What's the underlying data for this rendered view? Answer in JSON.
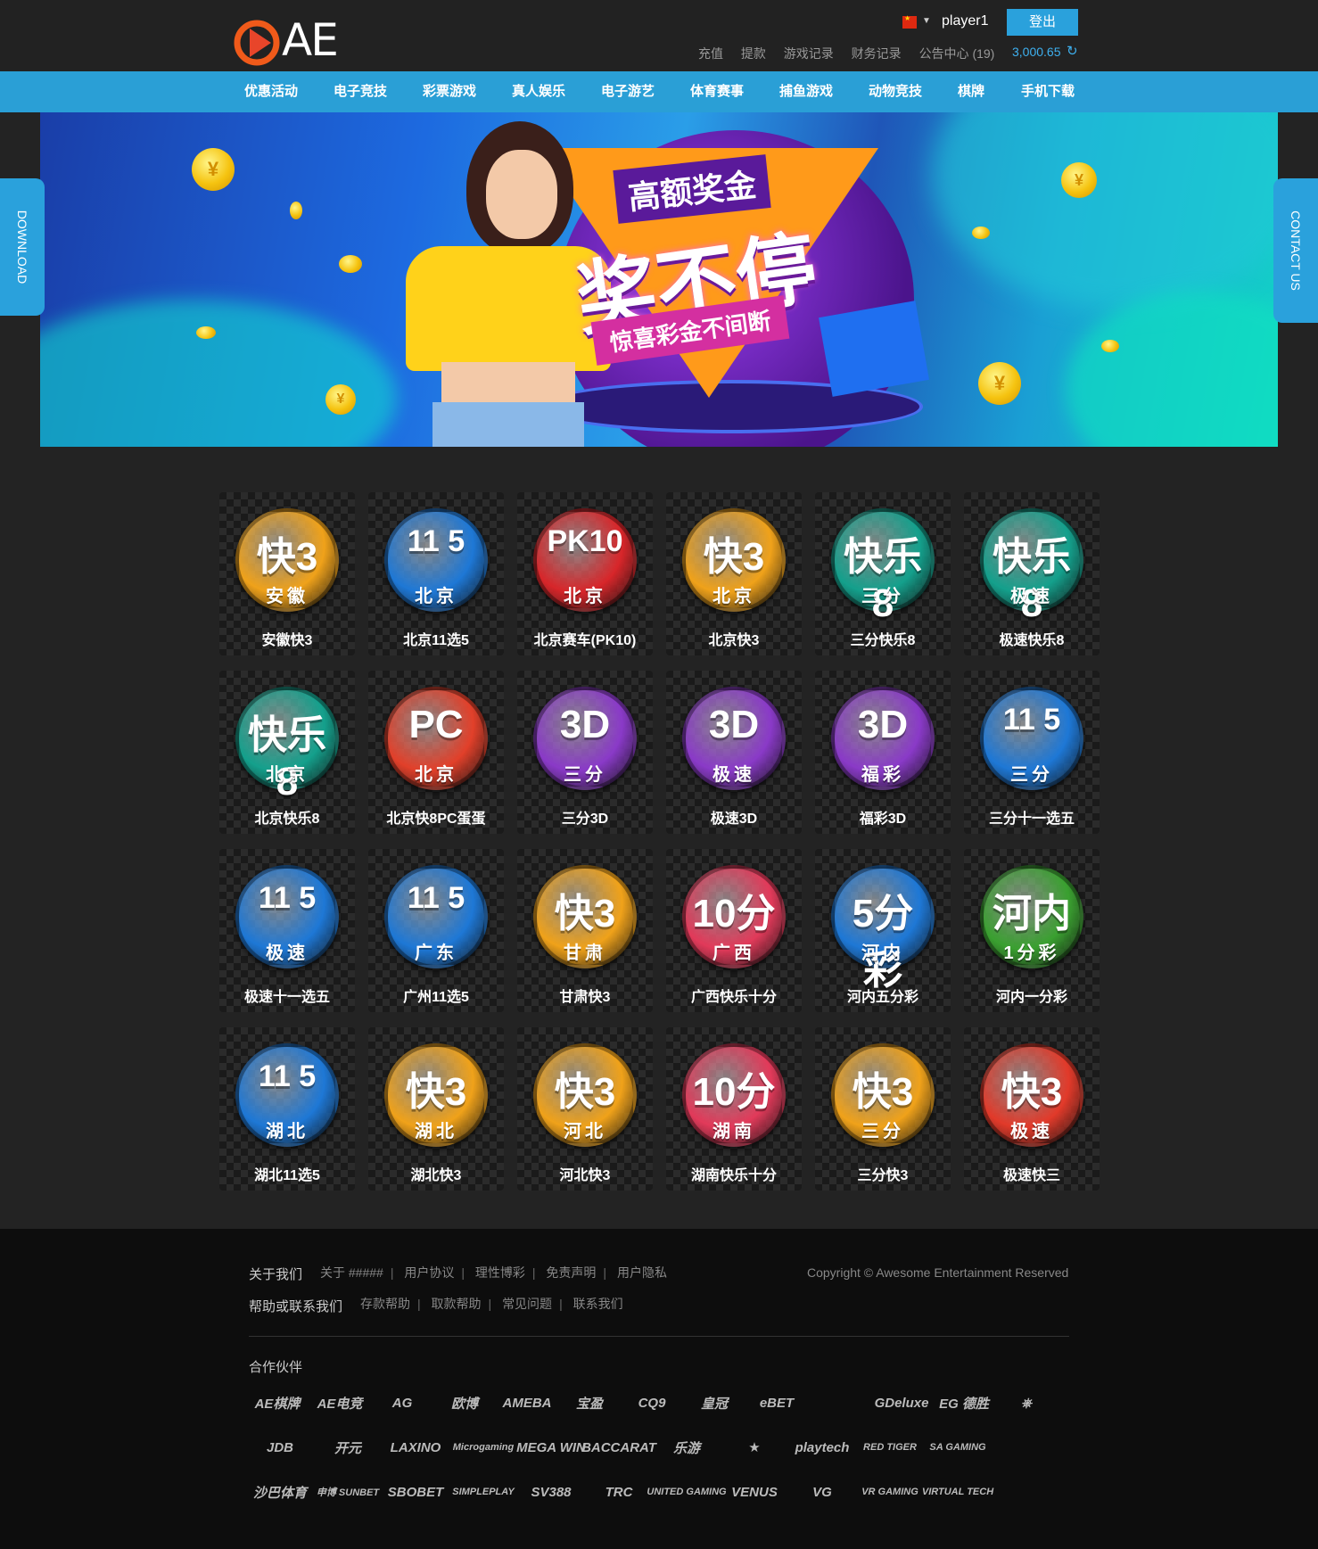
{
  "header": {
    "logo_text": "AE",
    "username": "player1",
    "logout_label": "登出",
    "links": [
      "充值",
      "提款",
      "游戏记录",
      "财务记录",
      "公告中心 (19)"
    ],
    "balance": "3,000.65"
  },
  "nav": [
    "优惠活动",
    "电子竞技",
    "彩票游戏",
    "真人娱乐",
    "电子游艺",
    "体育赛事",
    "捕鱼游戏",
    "动物竞技",
    "棋牌",
    "手机下载"
  ],
  "side": {
    "left": "DOWNLOAD",
    "right": "CONTACT US"
  },
  "banner": {
    "line1": "高额奖金",
    "line2": "奖不停",
    "line3": "惊喜彩金不间断"
  },
  "games": [
    {
      "big": "快3",
      "sub": "安徽",
      "name": "安徽快3",
      "color": "#f0a21a"
    },
    {
      "big": "11 5",
      "sub": "北京",
      "name": "北京11选5",
      "color": "#1e78d6"
    },
    {
      "big": "PK10",
      "sub": "北京",
      "name": "北京赛车(PK10)",
      "color": "#d8262a"
    },
    {
      "big": "快3",
      "sub": "北京",
      "name": "北京快3",
      "color": "#f0a21a"
    },
    {
      "big": "快乐8",
      "sub": "三分",
      "name": "三分快乐8",
      "color": "#14a08c"
    },
    {
      "big": "快乐8",
      "sub": "极速",
      "name": "极速快乐8",
      "color": "#14a08c"
    },
    {
      "big": "快乐8",
      "sub": "北京",
      "name": "北京快乐8",
      "color": "#14a08c"
    },
    {
      "big": "PC",
      "sub": "北京",
      "name": "北京快8PC蛋蛋",
      "color": "#e2402a"
    },
    {
      "big": "3D",
      "sub": "三分",
      "name": "三分3D",
      "color": "#8a3ac8"
    },
    {
      "big": "3D",
      "sub": "极速",
      "name": "极速3D",
      "color": "#8a3ac8"
    },
    {
      "big": "3D",
      "sub": "福彩",
      "name": "福彩3D",
      "color": "#8a3ac8"
    },
    {
      "big": "11 5",
      "sub": "三分",
      "name": "三分十一选五",
      "color": "#1e78d6"
    },
    {
      "big": "11 5",
      "sub": "极速",
      "name": "极速十一选五",
      "color": "#1e78d6"
    },
    {
      "big": "11 5",
      "sub": "广东",
      "name": "广州11选5",
      "color": "#1e78d6"
    },
    {
      "big": "快3",
      "sub": "甘肃",
      "name": "甘肃快3",
      "color": "#f0a21a"
    },
    {
      "big": "10分",
      "sub": "广西",
      "name": "广西快乐十分",
      "color": "#e23a5a"
    },
    {
      "big": "5分彩",
      "sub": "河内",
      "name": "河内五分彩",
      "color": "#1e78d6"
    },
    {
      "big": "河内",
      "sub": "1分彩",
      "name": "河内一分彩",
      "color": "#3aa030"
    },
    {
      "big": "11 5",
      "sub": "湖北",
      "name": "湖北11选5",
      "color": "#1e78d6"
    },
    {
      "big": "快3",
      "sub": "湖北",
      "name": "湖北快3",
      "color": "#f0a21a"
    },
    {
      "big": "快3",
      "sub": "河北",
      "name": "河北快3",
      "color": "#f0a21a"
    },
    {
      "big": "10分",
      "sub": "湖南",
      "name": "湖南快乐十分",
      "color": "#e23a5a"
    },
    {
      "big": "快3",
      "sub": "三分",
      "name": "三分快3",
      "color": "#f0a21a"
    },
    {
      "big": "快3",
      "sub": "极速",
      "name": "极速快三",
      "color": "#e23a2a"
    }
  ],
  "footer": {
    "about_label": "关于我们",
    "about_links": [
      "关于 #####",
      "用户协议",
      "理性博彩",
      "免责声明",
      "用户隐私"
    ],
    "help_label": "帮助或联系我们",
    "help_links": [
      "存款帮助",
      "取款帮助",
      "常见问题",
      "联系我们"
    ],
    "copyright": "Copyright © Awesome Entertainment Reserved",
    "partners_title": "合作伙伴",
    "partners": [
      [
        "AE棋牌",
        "AE电竞",
        "AG",
        "欧博",
        "AMEBA",
        "宝盈",
        "CQ9",
        "皇冠",
        "eBET",
        "",
        "GDeluxe",
        "EG 德胜",
        "⎈"
      ],
      [
        "JDB",
        "开元",
        "LAXINO",
        "Microgaming",
        "MEGA WIN",
        "BACCARAT",
        "乐游",
        "★",
        "playtech",
        "RED TIGER",
        "SA GAMING"
      ],
      [
        "沙巴体育",
        "申博 SUNBET",
        "SBOBET",
        "SIMPLEPLAY",
        "SV388",
        "TRC",
        "UNITED GAMING",
        "VENUS",
        "VG",
        "VR GAMING",
        "VIRTUAL TECH"
      ]
    ]
  }
}
